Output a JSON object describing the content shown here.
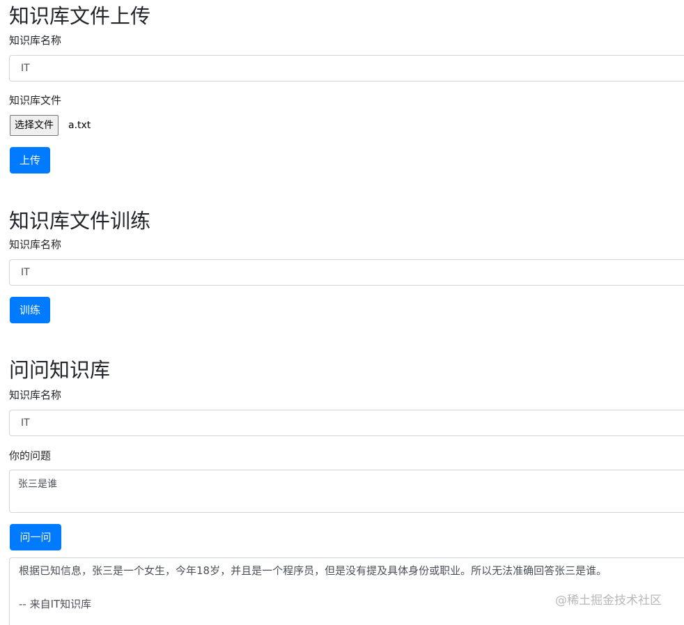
{
  "upload_section": {
    "title": "知识库文件上传",
    "name_label": "知识库名称",
    "name_value": "IT",
    "file_label": "知识库文件",
    "choose_file_label": "选择文件",
    "file_name": "a.txt",
    "upload_button": "上传"
  },
  "train_section": {
    "title": "知识库文件训练",
    "name_label": "知识库名称",
    "name_value": "IT",
    "train_button": "训练"
  },
  "ask_section": {
    "title": "问问知识库",
    "name_label": "知识库名称",
    "name_value": "IT",
    "question_label": "你的问题",
    "question_value": "张三是谁",
    "ask_button": "问一问",
    "answer_text": "根据已知信息，张三是一个女生，今年18岁，并且是一个程序员，但是没有提及具体身份或职业。所以无法准确回答张三是谁。",
    "answer_source": "-- 来自IT知识库"
  },
  "watermark": "@稀土掘金技术社区",
  "colors": {
    "primary": "#007bff",
    "border": "#ced4da",
    "text": "#212529"
  }
}
